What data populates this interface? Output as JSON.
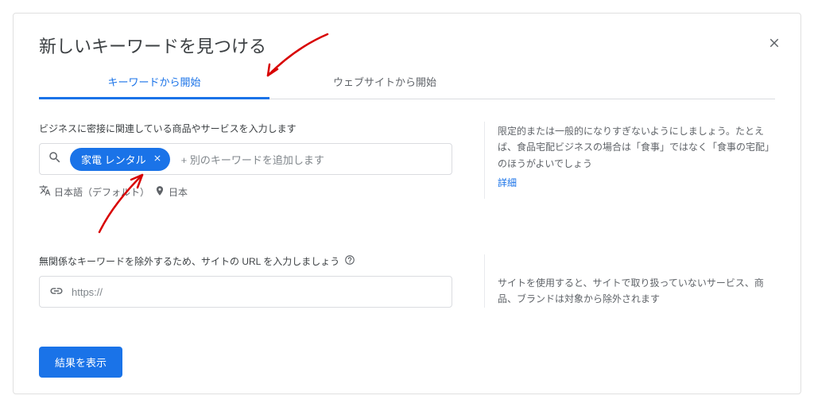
{
  "title": "新しいキーワードを見つける",
  "tabs": {
    "keyword": "キーワードから開始",
    "website": "ウェブサイトから開始"
  },
  "keywordSection": {
    "label": "ビジネスに密接に関連している商品やサービスを入力します",
    "chip": "家電 レンタル",
    "addPlaceholder": "+ 別のキーワードを追加します",
    "language": "日本語（デフォルト）",
    "location": "日本"
  },
  "tip1": {
    "text": "限定的または一般的になりすぎないようにしましょう。たとえば、食品宅配ビジネスの場合は「食事」ではなく「食事の宅配」のほうがよいでしょう",
    "linkText": "詳細"
  },
  "urlSection": {
    "label": "無関係なキーワードを除外するため、サイトの URL を入力しましょう",
    "placeholder": "https://"
  },
  "tip2": {
    "text": "サイトを使用すると、サイトで取り扱っていないサービス、商品、ブランドは対象から除外されます"
  },
  "submitLabel": "結果を表示"
}
